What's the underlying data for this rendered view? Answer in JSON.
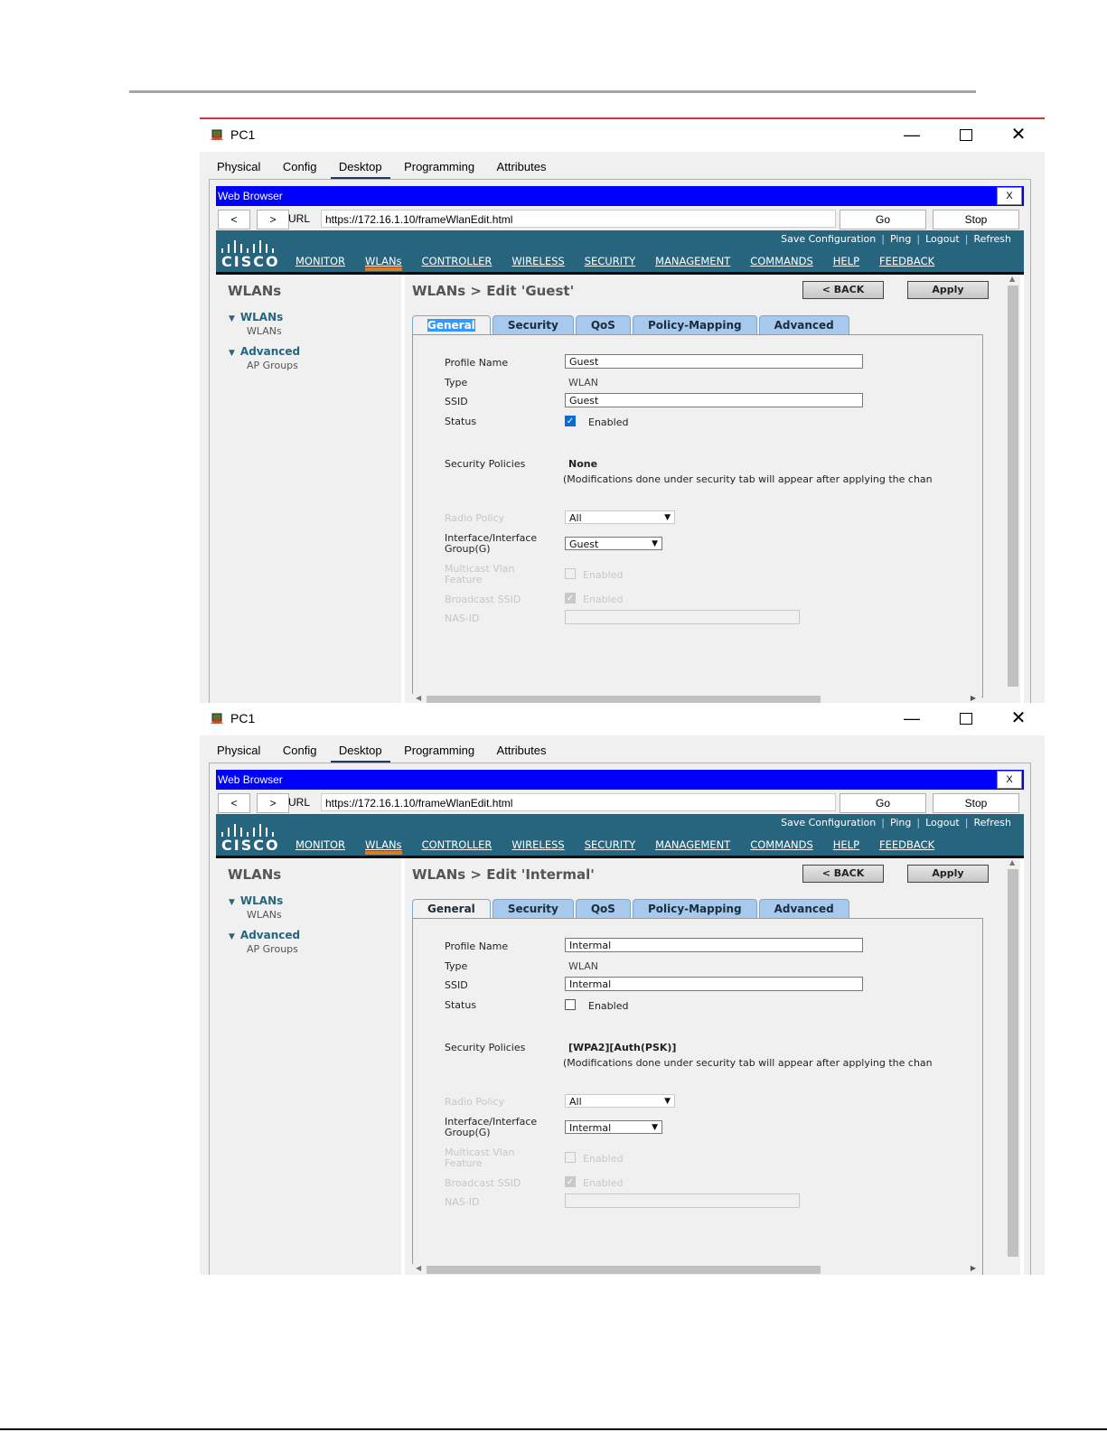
{
  "windows": [
    {
      "title": "PC1",
      "app_tabs": [
        "Physical",
        "Config",
        "Desktop",
        "Programming",
        "Attributes"
      ],
      "active_app_tab": "Desktop",
      "browser": {
        "title": "Web Browser",
        "close": "X",
        "back": "<",
        "forward": ">",
        "url_label": "URL",
        "url": "https://172.16.1.10/frameWlanEdit.html",
        "go": "Go",
        "stop": "Stop"
      },
      "cisco": {
        "logo": "CISCO",
        "header_links": [
          "Save Configuration",
          "Ping",
          "Logout",
          "Refresh"
        ],
        "menu": [
          "MONITOR",
          "WLANs",
          "CONTROLLER",
          "WIRELESS",
          "SECURITY",
          "MANAGEMENT",
          "COMMANDS",
          "HELP",
          "FEEDBACK"
        ],
        "selected_menu": "WLANs"
      },
      "sidebar": {
        "title": "WLANs",
        "sections": [
          {
            "label": "WLANs",
            "sub": "WLANs"
          },
          {
            "label": "Advanced",
            "sub": "AP Groups"
          }
        ]
      },
      "page": {
        "title": "WLANs > Edit  'Guest'",
        "back_button": "< BACK",
        "apply_button": "Apply",
        "tabs": [
          "General",
          "Security",
          "QoS",
          "Policy-Mapping",
          "Advanced"
        ],
        "active_tab": "General",
        "general": {
          "profile_name_label": "Profile Name",
          "profile_name": "Guest",
          "type_label": "Type",
          "type": "WLAN",
          "ssid_label": "SSID",
          "ssid": "Guest",
          "status_label": "Status",
          "status_checked": true,
          "status_text": "Enabled",
          "security_policies_label": "Security Policies",
          "security_policies": "None",
          "security_note": "(Modifications done under security tab will appear after applying the chan",
          "radio_policy_label": "Radio Policy",
          "radio_policy": "All",
          "interface_label_1": "Interface/Interface",
          "interface_label_2": "Group(G)",
          "interface": "Guest",
          "multicast_label_1": "Multicast Vlan",
          "multicast_label_2": "Feature",
          "multicast_text": "Enabled",
          "broadcast_label": "Broadcast SSID",
          "broadcast_text": "Enabled",
          "nas_id_label": "NAS-ID",
          "nas_id": ""
        }
      }
    },
    {
      "title": "PC1",
      "app_tabs": [
        "Physical",
        "Config",
        "Desktop",
        "Programming",
        "Attributes"
      ],
      "active_app_tab": "Desktop",
      "browser": {
        "title": "Web Browser",
        "close": "X",
        "back": "<",
        "forward": ">",
        "url_label": "URL",
        "url": "https://172.16.1.10/frameWlanEdit.html",
        "go": "Go",
        "stop": "Stop"
      },
      "cisco": {
        "logo": "CISCO",
        "header_links": [
          "Save Configuration",
          "Ping",
          "Logout",
          "Refresh"
        ],
        "menu": [
          "MONITOR",
          "WLANs",
          "CONTROLLER",
          "WIRELESS",
          "SECURITY",
          "MANAGEMENT",
          "COMMANDS",
          "HELP",
          "FEEDBACK"
        ],
        "selected_menu": "WLANs"
      },
      "sidebar": {
        "title": "WLANs",
        "sections": [
          {
            "label": "WLANs",
            "sub": "WLANs"
          },
          {
            "label": "Advanced",
            "sub": "AP Groups"
          }
        ]
      },
      "page": {
        "title": "WLANs > Edit  'Intermal'",
        "back_button": "< BACK",
        "apply_button": "Apply",
        "tabs": [
          "General",
          "Security",
          "QoS",
          "Policy-Mapping",
          "Advanced"
        ],
        "active_tab": "General",
        "general": {
          "profile_name_label": "Profile Name",
          "profile_name": "Intermal",
          "type_label": "Type",
          "type": "WLAN",
          "ssid_label": "SSID",
          "ssid": "Intermal",
          "status_label": "Status",
          "status_checked": false,
          "status_text": "Enabled",
          "security_policies_label": "Security Policies",
          "security_policies": "[WPA2][Auth(PSK)]",
          "security_note": "(Modifications done under security tab will appear after applying the chan",
          "radio_policy_label": "Radio Policy",
          "radio_policy": "All",
          "interface_label_1": "Interface/Interface",
          "interface_label_2": "Group(G)",
          "interface": "Intermal",
          "multicast_label_1": "Multicast Vlan",
          "multicast_label_2": "Feature",
          "multicast_text": "Enabled",
          "broadcast_label": "Broadcast SSID",
          "broadcast_text": "Enabled",
          "nas_id_label": "NAS-ID",
          "nas_id": ""
        }
      }
    }
  ],
  "colors": {
    "browser_title_bar": "#0000ff",
    "cisco_header": "#27657e",
    "menu_selected_underline": "#e07a1e",
    "tab_background": "#a7c9ee",
    "window_accent_border": "#d13438"
  }
}
